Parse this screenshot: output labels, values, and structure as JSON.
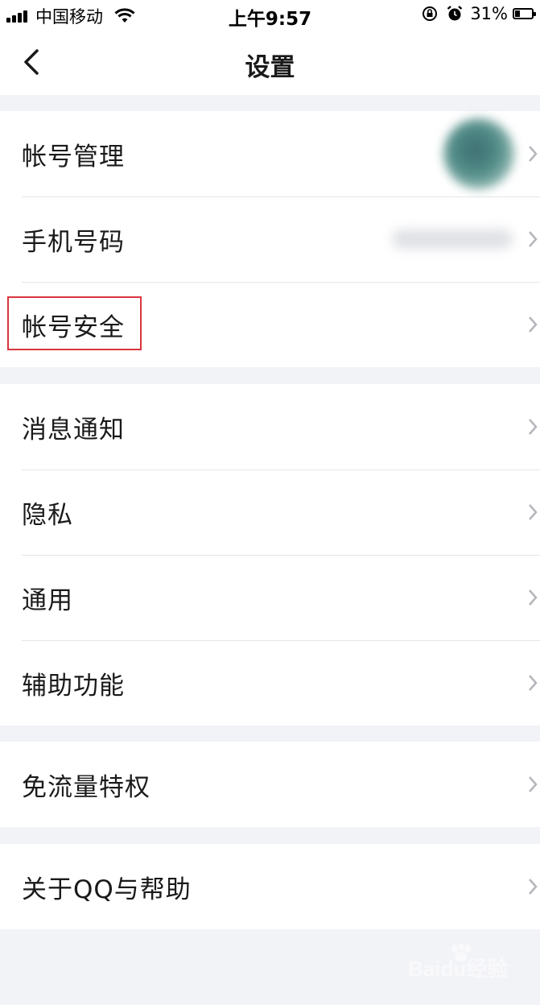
{
  "status_bar": {
    "carrier": "中国移动",
    "time": "上午9:57",
    "battery": "31%",
    "battery_level": 0.31
  },
  "nav": {
    "title": "设置"
  },
  "groups": [
    {
      "items": [
        {
          "label": "帐号管理"
        },
        {
          "label": "手机号码"
        },
        {
          "label": "帐号安全"
        }
      ]
    },
    {
      "items": [
        {
          "label": "消息通知"
        },
        {
          "label": "隐私"
        },
        {
          "label": "通用"
        },
        {
          "label": "辅助功能"
        }
      ]
    },
    {
      "items": [
        {
          "label": "免流量特权"
        }
      ]
    },
    {
      "items": [
        {
          "label": "关于QQ与帮助"
        }
      ]
    }
  ],
  "watermark": {
    "text": "Baidu经验"
  },
  "colors": {
    "highlight": "#d9363e",
    "background": "#f2f3f7"
  }
}
